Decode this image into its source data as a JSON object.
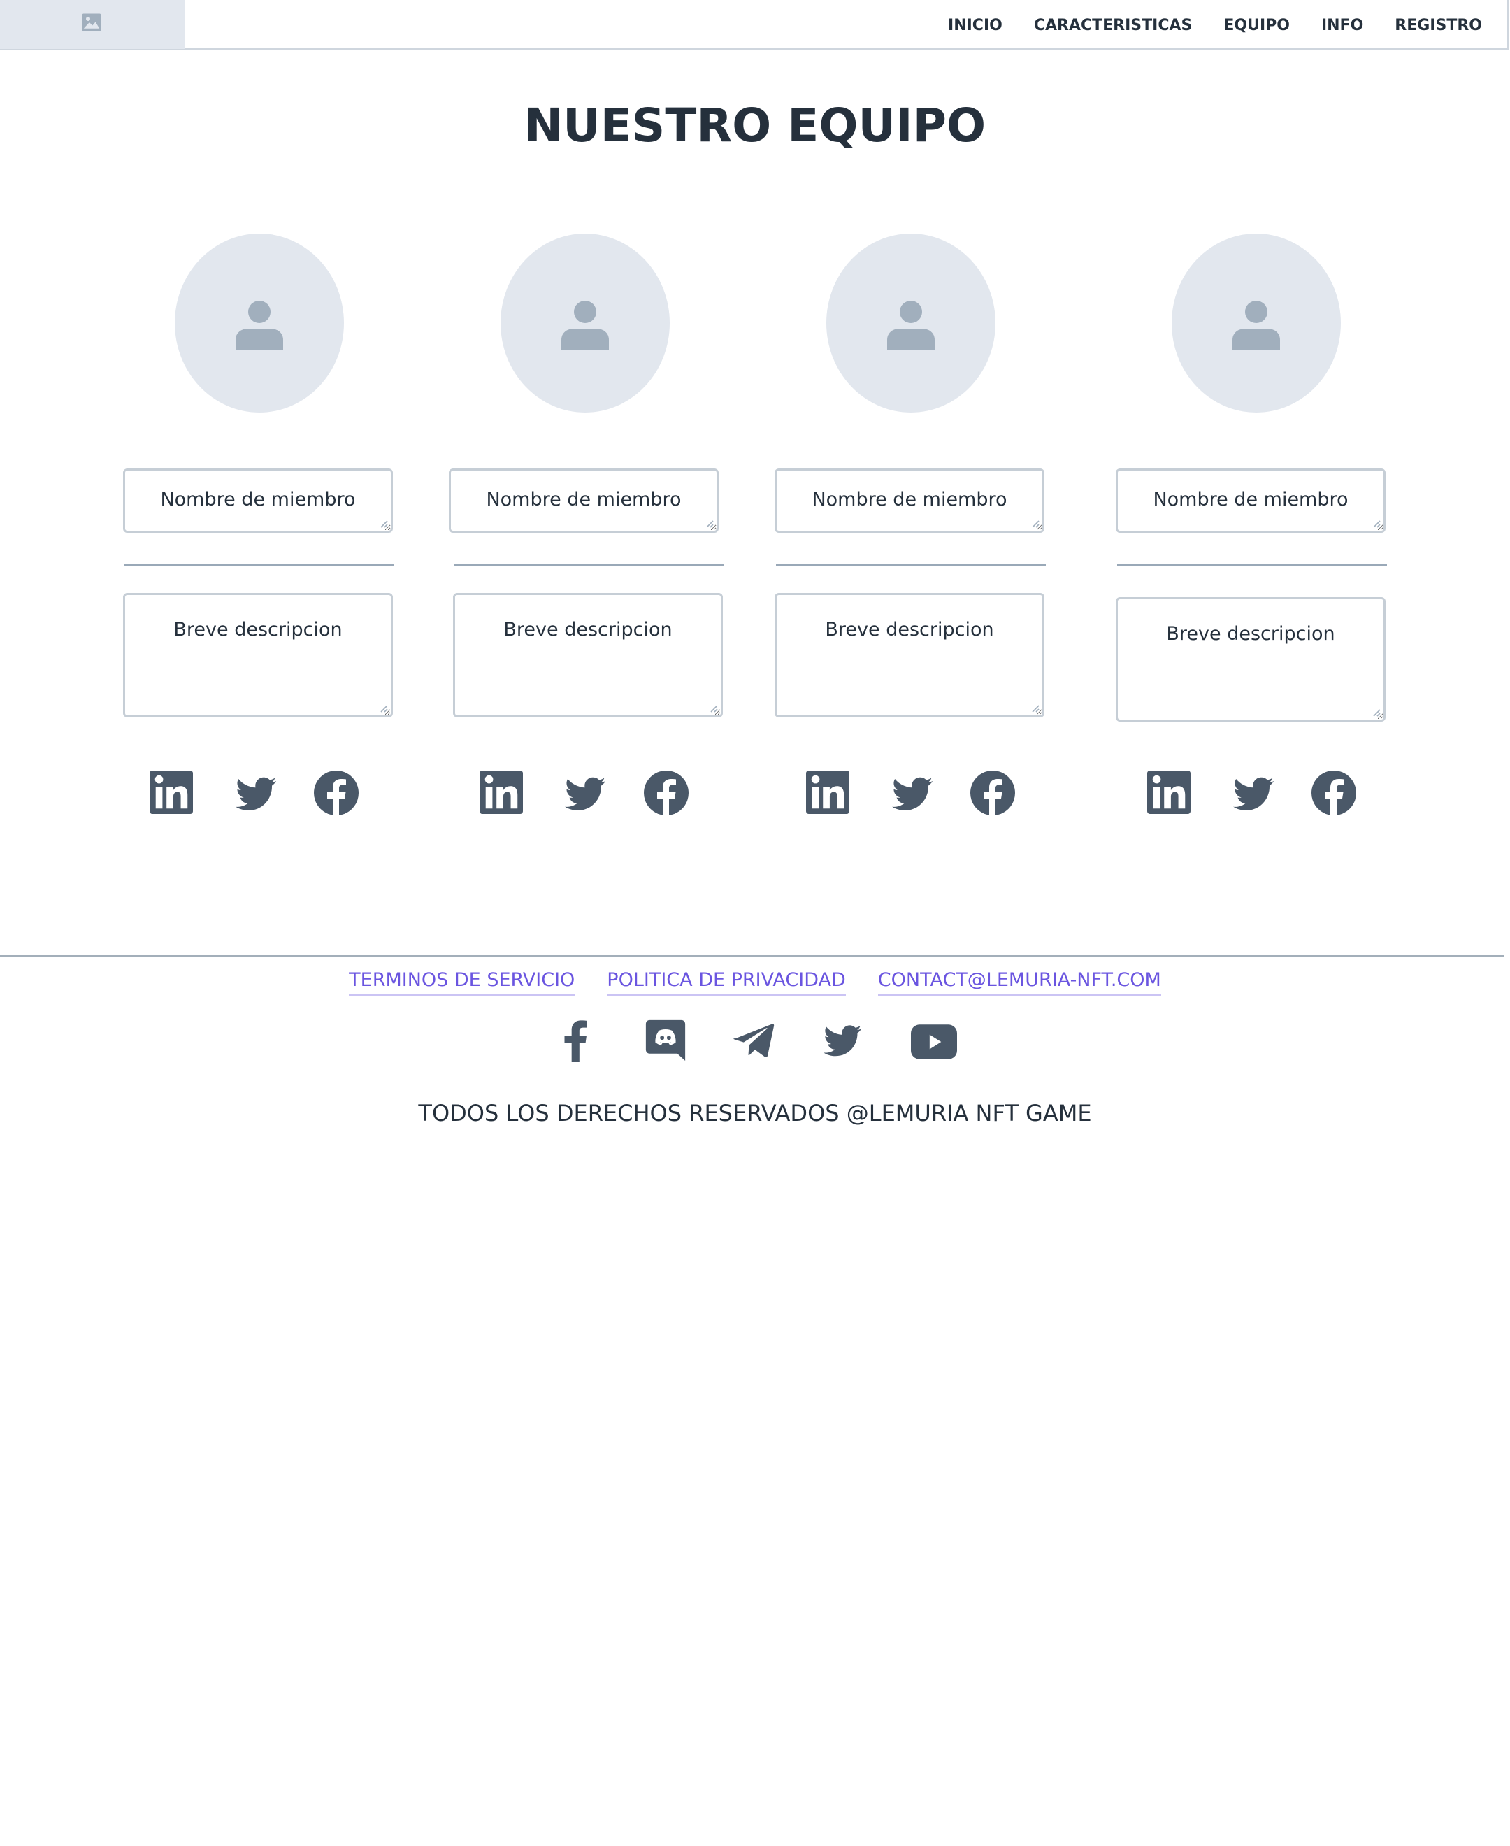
{
  "nav": {
    "logo_icon": "image-placeholder-icon",
    "items": [
      {
        "label": "INICIO"
      },
      {
        "label": "CARACTERISTICAS"
      },
      {
        "label": "EQUIPO"
      },
      {
        "label": "INFO"
      },
      {
        "label": "REGISTRO"
      }
    ]
  },
  "page": {
    "title": "NUESTRO EQUIPO"
  },
  "team": {
    "members": [
      {
        "name_placeholder": "Nombre de miembro",
        "description_placeholder": "Breve descripcion",
        "socials": [
          "linkedin-icon",
          "twitter-icon",
          "facebook-icon"
        ]
      },
      {
        "name_placeholder": "Nombre de miembro",
        "description_placeholder": "Breve descripcion",
        "socials": [
          "linkedin-icon",
          "twitter-icon",
          "facebook-icon"
        ]
      },
      {
        "name_placeholder": "Nombre de miembro",
        "description_placeholder": "Breve descripcion",
        "socials": [
          "linkedin-icon",
          "twitter-icon",
          "facebook-icon"
        ]
      },
      {
        "name_placeholder": "Nombre de miembro",
        "description_placeholder": "Breve descripcion",
        "socials": [
          "linkedin-icon",
          "twitter-icon",
          "facebook-icon"
        ]
      }
    ]
  },
  "footer": {
    "links": [
      {
        "label": "TERMINOS DE SERVICIO"
      },
      {
        "label": "POLITICA DE PRIVACIDAD"
      },
      {
        "label": "CONTACT@LEMURIA-NFT.COM"
      }
    ],
    "socials": [
      "facebook-icon",
      "discord-icon",
      "telegram-icon",
      "twitter-icon",
      "youtube-icon"
    ],
    "copyright": "TODOS LOS DERECHOS RESERVADOS @LEMURIA NFT GAME"
  },
  "colors": {
    "text": "#25303c",
    "icon": "#4a5868",
    "placeholder_bg": "#e2e7ee",
    "placeholder_icon": "#a1afbd",
    "link": "#6a55e0",
    "border": "#c6ced6"
  }
}
